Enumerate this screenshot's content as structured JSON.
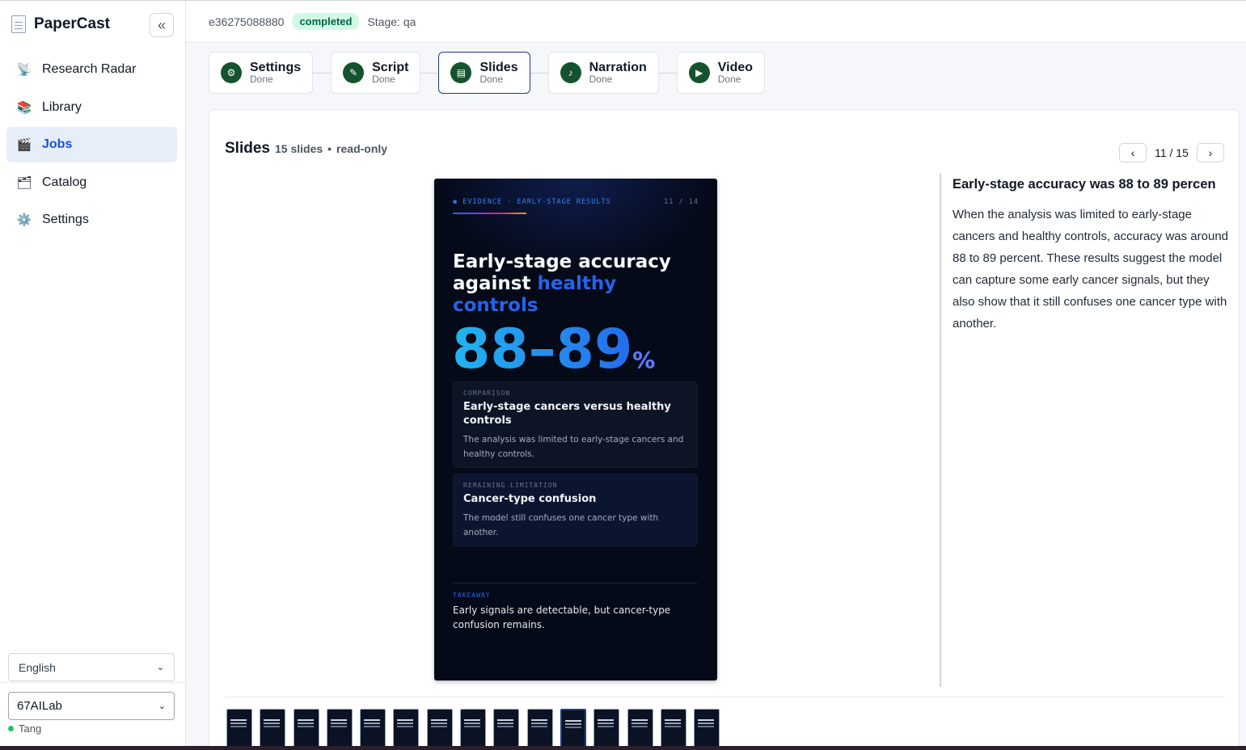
{
  "app": {
    "name": "PaperCast",
    "collapse_icon": "«"
  },
  "sidebar": {
    "items": [
      {
        "label": "Research Radar",
        "icon": "satellite-dish-icon",
        "glyph": "📡",
        "active": false
      },
      {
        "label": "Library",
        "icon": "books-icon",
        "glyph": "📚",
        "active": false
      },
      {
        "label": "Jobs",
        "icon": "clapper-board-icon",
        "glyph": "🎬",
        "active": true
      },
      {
        "label": "Catalog",
        "icon": "card-box-icon",
        "glyph": "🗂",
        "active": false
      },
      {
        "label": "Settings",
        "icon": "gear-icon",
        "glyph": "⚙️",
        "active": false
      }
    ],
    "language": "English",
    "org": "67AILab",
    "user": "Tang"
  },
  "header": {
    "job_id": "e36275088880",
    "status": "completed",
    "stage": "Stage: qa"
  },
  "steps": [
    {
      "label": "Settings",
      "status": "Done",
      "icon": "gear-icon",
      "glyph": "⚙"
    },
    {
      "label": "Script",
      "status": "Done",
      "icon": "pencil-icon",
      "glyph": "✎"
    },
    {
      "label": "Slides",
      "status": "Done",
      "icon": "slides-icon",
      "glyph": "▤"
    },
    {
      "label": "Narration",
      "status": "Done",
      "icon": "music-note-icon",
      "glyph": "♪"
    },
    {
      "label": "Video",
      "status": "Done",
      "icon": "play-icon",
      "glyph": "▶"
    }
  ],
  "panel": {
    "title": "Slides",
    "count": "15 slides",
    "sep": "•",
    "mode": "read-only",
    "pager": {
      "prev": "‹",
      "next": "›",
      "current": "11 / 15"
    }
  },
  "slide": {
    "kicker": "◉ EVIDENCE · EARLY-STAGE RESULTS",
    "page": "11 / 14",
    "headline_a": "Early-stage accuracy against ",
    "headline_b": "healthy controls",
    "big": "88–89",
    "pct": "%",
    "card1": {
      "label": "COMPARISON",
      "title": "Early-stage cancers versus healthy controls",
      "body": "The analysis was limited to early-stage cancers and healthy controls."
    },
    "card2": {
      "label": "REMAINING LIMITATION",
      "title": "Cancer-type confusion",
      "body": "The model still confuses one cancer type with another."
    },
    "takeaway_label": "TAKEAWAY",
    "takeaway": "Early signals are detectable, but cancer-type confusion remains."
  },
  "notes": {
    "title": "Early-stage accuracy was 88 to 89 percen",
    "body": "When the analysis was limited to early-stage cancers and healthy controls, accuracy was around 88 to 89 percent. These results suggest the model can capture some early cancer signals, but they also show that it still confuses one cancer type with another."
  },
  "thumbnails": {
    "total": 15,
    "active_index": 10
  }
}
